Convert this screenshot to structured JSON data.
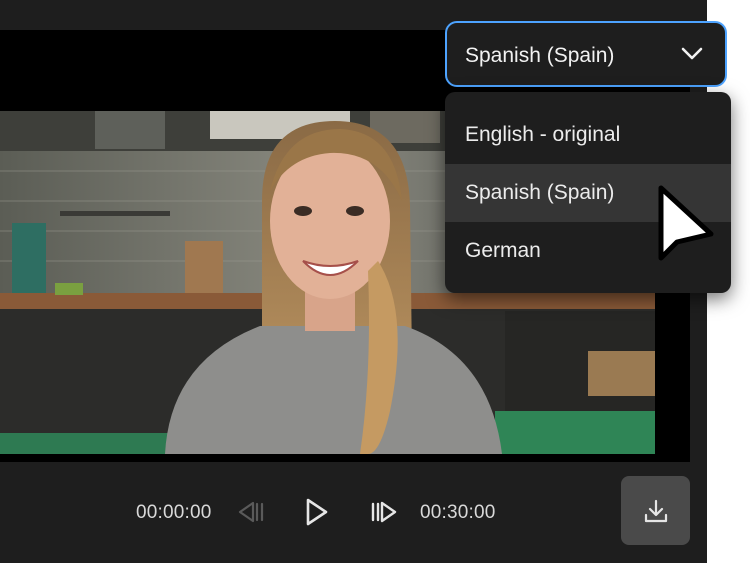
{
  "player": {
    "current_time": "00:00:00",
    "total_time": "00:30:00"
  },
  "language_select": {
    "selected": "Spanish (Spain)",
    "options": [
      "English - original",
      "Spanish (Spain)",
      "German"
    ],
    "highlighted": "Spanish (Spain)"
  },
  "colors": {
    "focus_ring": "#4da3ff",
    "panel": "#1e1e1e",
    "menu_hover": "#353535",
    "download_button": "#4a4a4a"
  },
  "icons": {
    "skip_back": "step-back-icon",
    "play": "play-icon",
    "skip_forward": "step-forward-icon",
    "download": "download-icon",
    "dropdown": "chevron-down-icon",
    "pointer": "mouse-cursor-icon"
  }
}
